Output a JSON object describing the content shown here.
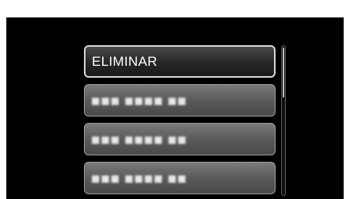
{
  "menu": {
    "items": [
      {
        "label": "ELIMINAR",
        "selected": true,
        "obscured": false
      },
      {
        "label": "■■■ ■■■■ ■■",
        "selected": false,
        "obscured": true
      },
      {
        "label": "■■■ ■■■■ ■■",
        "selected": false,
        "obscured": true
      },
      {
        "label": "■■■ ■■■■ ■■",
        "selected": false,
        "obscured": true
      }
    ]
  },
  "scrollbar": {
    "thumb_position": 0,
    "thumb_fraction": 0.34
  },
  "colors": {
    "screen_background": "#000000",
    "item_border_selected": "#d6d6d6",
    "item_text": "#ffffff"
  }
}
